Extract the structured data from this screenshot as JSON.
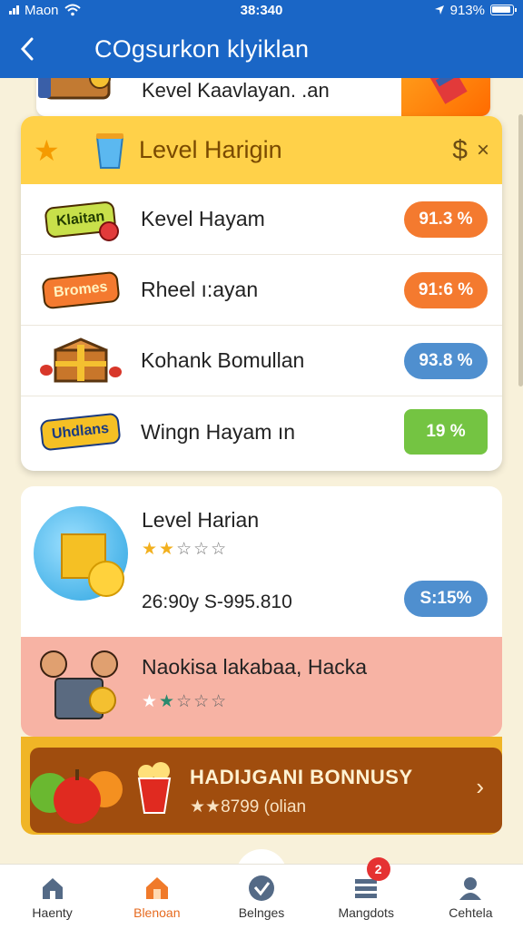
{
  "status_bar": {
    "carrier": "Maon",
    "time": "38:340",
    "battery": "913%"
  },
  "app_bar": {
    "title": "COgsurkon klyiklan"
  },
  "partial_item": {
    "label": "Kevel Kaavlayan. .an"
  },
  "level_list": {
    "header_title": "Level Harigin",
    "header_currency": "$",
    "header_close": "×",
    "rows": [
      {
        "badge_text": "Klaitan",
        "label": "Kevel Hayam",
        "value": "91.3 %",
        "color": "orange"
      },
      {
        "badge_text": "Bromes",
        "label": "Rheel ı:ayan",
        "value": "91:6 %",
        "color": "orange"
      },
      {
        "badge_text": "",
        "label": "Kohank Bomullan",
        "value": "93.8 %",
        "color": "blue"
      },
      {
        "badge_text": "Uhdlans",
        "label": "Wingn Hayam ın",
        "value": "19 %",
        "color": "green"
      }
    ]
  },
  "level_card": {
    "title": "Level Harian",
    "rating": 2,
    "stats": "26:90y S-995.810",
    "value": "S:15%"
  },
  "promo_card": {
    "title": "Naokisa lakabaa, Hacka",
    "rating": 2
  },
  "bonus": {
    "title": "HADIJGANI BONNUSY",
    "subtitle": "★★8799 (olian"
  },
  "bottom_nav": [
    {
      "label": "Haenty",
      "icon": "home-icon",
      "active": false
    },
    {
      "label": "Blenoan",
      "icon": "house-icon",
      "active": true
    },
    {
      "label": "Belnges",
      "icon": "check-circle-icon",
      "active": false
    },
    {
      "label": "Mangdots",
      "icon": "list-icon",
      "active": false,
      "badge": "2"
    },
    {
      "label": "Cehtela",
      "icon": "profile-icon",
      "active": false
    }
  ]
}
